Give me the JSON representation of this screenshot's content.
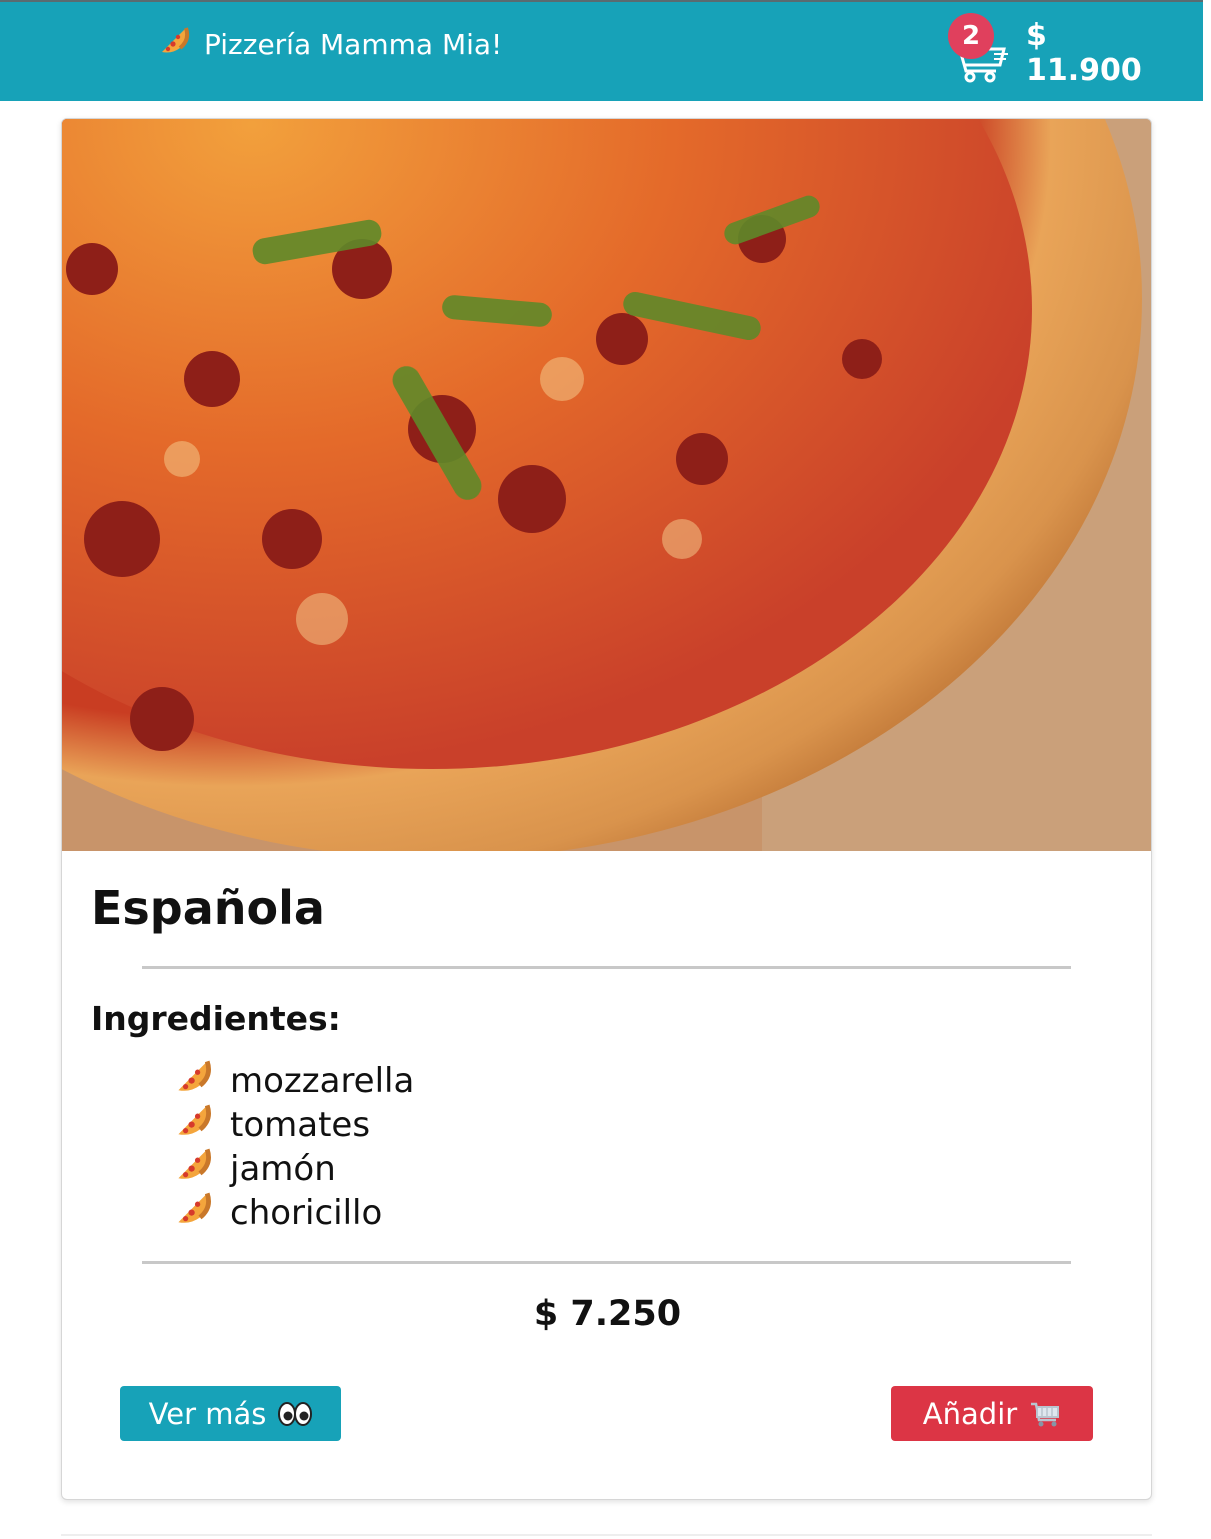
{
  "navbar": {
    "brand_label": "Pizzería Mamma Mia!",
    "cart_count": "2",
    "cart_total": "$ 11.900",
    "brand_icon": "pizza-icon",
    "cart_icon": "cart-icon",
    "background": "#17a2b8"
  },
  "card": {
    "image_alt": "Pizza Española",
    "title": "Española",
    "ingredients_title": "Ingredientes:",
    "ingredients": [
      "mozzarella",
      "tomates",
      "jamón",
      "choricillo"
    ],
    "price": "$ 7.250",
    "more_button_label": "Ver más",
    "more_button_icon": "eyes-icon",
    "add_button_label": "Añadir",
    "add_button_icon": "cart-icon",
    "more_button_color": "#17a2b8",
    "add_button_color": "#dc3545"
  }
}
